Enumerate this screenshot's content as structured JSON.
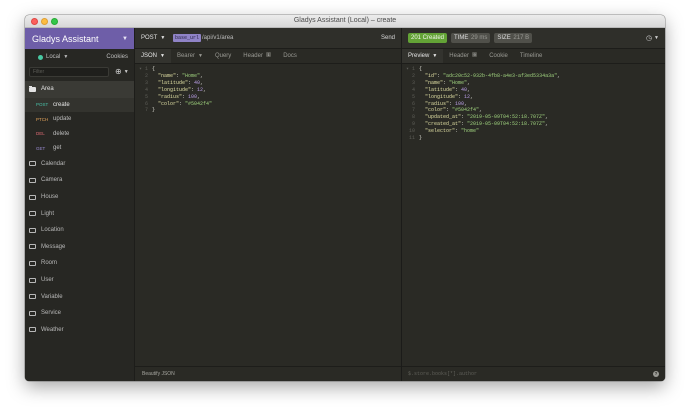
{
  "window": {
    "title": "Gladys Assistant (Local) – create"
  },
  "sidebar": {
    "workspace_name": "Gladys Assistant",
    "environment": "Local",
    "cookies_label": "Cookies",
    "filter_placeholder": "Filter",
    "open_folder": "Area",
    "requests": [
      {
        "method": "POST",
        "name": "create"
      },
      {
        "method": "PTCH",
        "name": "update"
      },
      {
        "method": "DEL",
        "name": "delete"
      },
      {
        "method": "GET",
        "name": "get"
      }
    ],
    "folders": [
      "Calendar",
      "Camera",
      "House",
      "Light",
      "Location",
      "Message",
      "Room",
      "User",
      "Variable",
      "Service",
      "Weather"
    ]
  },
  "request": {
    "method": "POST",
    "url_variable": "base_url",
    "url_path": "/api/v1/area",
    "send_label": "Send",
    "tabs": [
      {
        "label": "JSON",
        "active": true,
        "has_caret": true
      },
      {
        "label": "Bearer",
        "has_caret": true
      },
      {
        "label": "Query"
      },
      {
        "label": "Header",
        "count": "1"
      },
      {
        "label": "Docs"
      }
    ],
    "body_lines": [
      "{",
      "  \"name\": \"Home\",",
      "  \"latitude\": 40,",
      "  \"longitude\": 12,",
      "  \"radius\": 100,",
      "  \"color\": \"#5042f4\"",
      "}"
    ],
    "footer_label": "Beautify JSON"
  },
  "response": {
    "status": "201 Created",
    "time_label": "TIME",
    "time_value": "29 ms",
    "size_label": "SIZE",
    "size_value": "217 B",
    "tabs": [
      {
        "label": "Preview",
        "active": true,
        "has_caret": true
      },
      {
        "label": "Header",
        "count": "9"
      },
      {
        "label": "Cookie"
      },
      {
        "label": "Timeline"
      }
    ],
    "body_lines": [
      "{",
      "  \"id\": \"adc20c52-932b-4fb8-a4e3-af3ed5334a3a\",",
      "  \"name\": \"Home\",",
      "  \"latitude\": 40,",
      "  \"longitude\": 12,",
      "  \"radius\": 100,",
      "  \"color\": \"#5042f4\",",
      "  \"updated_at\": \"2019-05-09T04:52:18.707Z\",",
      "  \"created_at\": \"2019-05-09T04:52:18.707Z\",",
      "  \"selector\": \"home\"",
      "}"
    ],
    "filter_placeholder": "$.store.books[*].author",
    "help_glyph": "?"
  },
  "colors": {
    "workspace": "#6e5ea8",
    "status_ok": "#63a336",
    "variable_chip": "#8f83c6"
  }
}
